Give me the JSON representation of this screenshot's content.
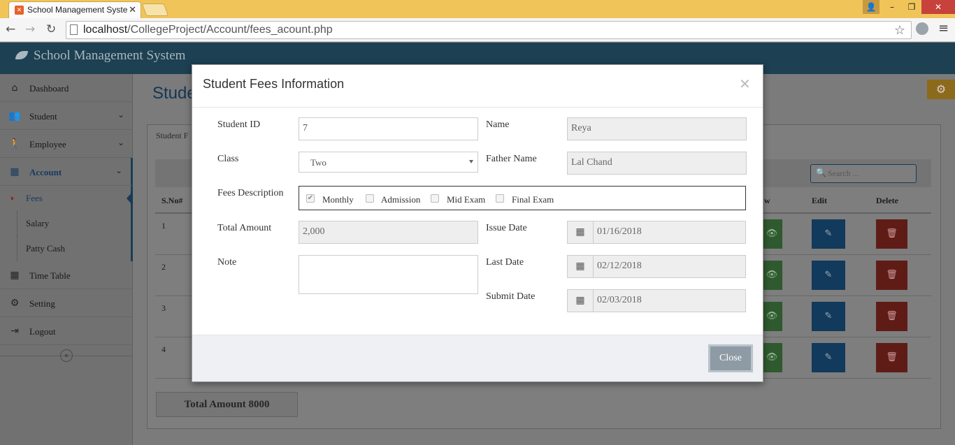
{
  "browser": {
    "tab_title": "School Management Syste",
    "url_host": "localhost",
    "url_path": "/CollegeProject/Account/fees_acount.php"
  },
  "app": {
    "title": "School Management System",
    "page_title": "Stude",
    "panel_tab": "Student F"
  },
  "sidebar": {
    "items": [
      {
        "label": "Dashboard",
        "icon": "home-icon"
      },
      {
        "label": "Student",
        "icon": "users-icon"
      },
      {
        "label": "Employee",
        "icon": "employee-icon"
      },
      {
        "label": "Account",
        "icon": "table-icon"
      },
      {
        "label": "Time Table",
        "icon": "calendar-icon"
      },
      {
        "label": "Setting",
        "icon": "gear-icon"
      },
      {
        "label": "Logout",
        "icon": "logout-icon"
      }
    ],
    "sub_items": [
      "Fees",
      "Salary",
      "Patty Cash"
    ]
  },
  "table": {
    "search_placeholder": "Search ...",
    "headers": {
      "sno": "S.No#",
      "view": "w",
      "edit": "Edit",
      "delete": "Delete"
    },
    "rows": [
      "1",
      "2",
      "3",
      "4"
    ],
    "total": "Total Amount 8000"
  },
  "modal": {
    "title": "Student Fees Information",
    "labels": {
      "student_id": "Student ID",
      "name": "Name",
      "class": "Class",
      "father_name": "Father Name",
      "fees_description": "Fees Description",
      "total_amount": "Total Amount",
      "issue_date": "Issue Date",
      "note": "Note",
      "last_date": "Last Date",
      "submit_date": "Submit Date"
    },
    "values": {
      "student_id": "7",
      "name": "Reya",
      "class": "Two",
      "father_name": "Lal Chand",
      "total_amount": "2,000",
      "issue_date": "01/16/2018",
      "last_date": "02/12/2018",
      "submit_date": "02/03/2018",
      "note": ""
    },
    "fees_options": [
      {
        "label": "Monthly",
        "checked": true
      },
      {
        "label": "Admission",
        "checked": false
      },
      {
        "label": "Mid Exam",
        "checked": false
      },
      {
        "label": "Final Exam",
        "checked": false
      }
    ],
    "close_label": "Close"
  }
}
